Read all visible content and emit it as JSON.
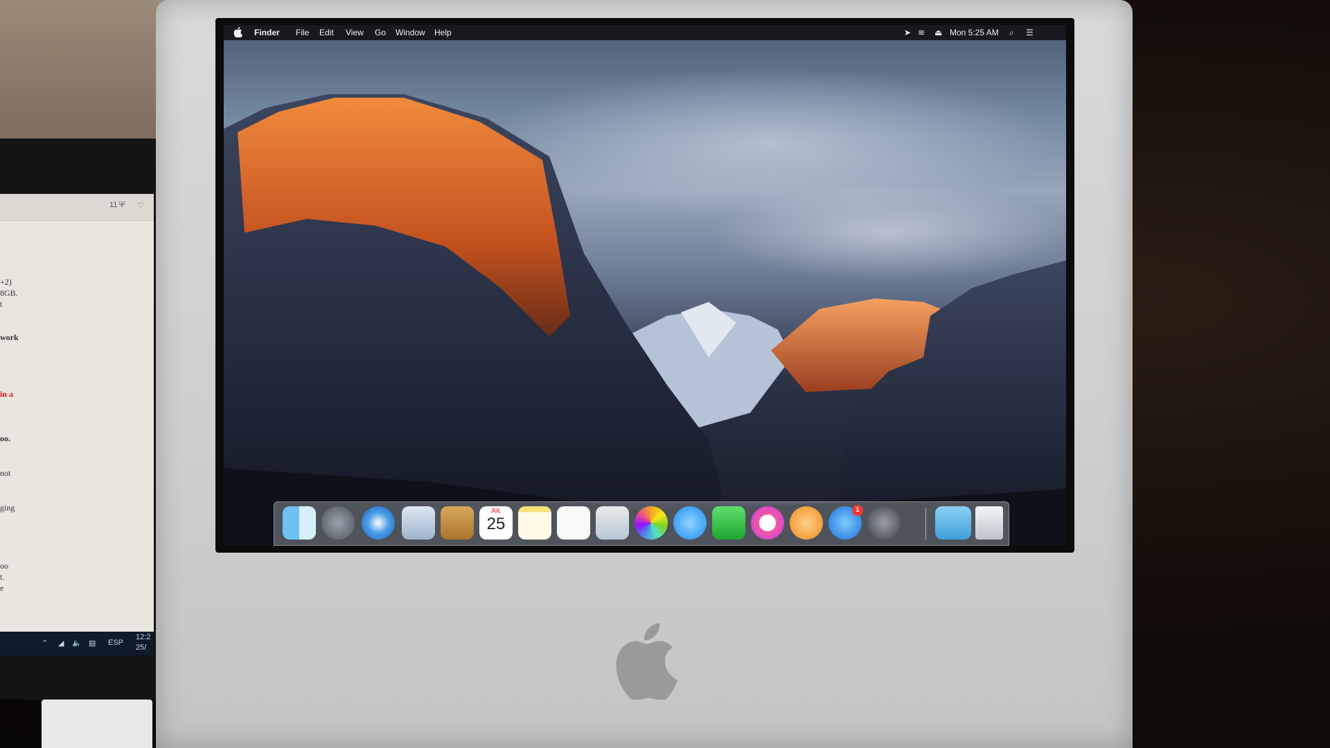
{
  "menubar": {
    "app_name": "Finder",
    "menus": [
      "File",
      "Edit",
      "View",
      "Go",
      "Window",
      "Help"
    ],
    "clock": "Mon 5:25 AM",
    "icons": [
      "apple-icon",
      "location-icon",
      "wifi-icon",
      "eject-icon",
      "spotlight-icon",
      "notification-center-icon"
    ]
  },
  "dock": {
    "calendar": {
      "month": "JUL",
      "day": "25"
    },
    "app_store_badge": "1",
    "items": [
      "finder",
      "launchpad",
      "safari",
      "mail",
      "contacts",
      "calendar",
      "notes",
      "reminders",
      "preview",
      "photos",
      "messages",
      "facetime",
      "itunes",
      "ibooks",
      "app-store",
      "system-preferences",
      "downloads",
      "trash"
    ]
  },
  "second_monitor": {
    "toolbar_count": "11",
    "text_lines": [
      "+2)",
      "8GB.",
      "t",
      "work",
      "in a",
      "oo.",
      "not",
      "ging",
      "oo",
      "t.",
      "e"
    ],
    "taskbar_lang": "ESP",
    "taskbar_time": "12:2",
    "taskbar_date": "25/"
  },
  "colors": {
    "menubar": "#141418",
    "rock_orange": "#d9642a",
    "sky": "#7f8fa8",
    "imac_body": "#d6d6d6"
  }
}
